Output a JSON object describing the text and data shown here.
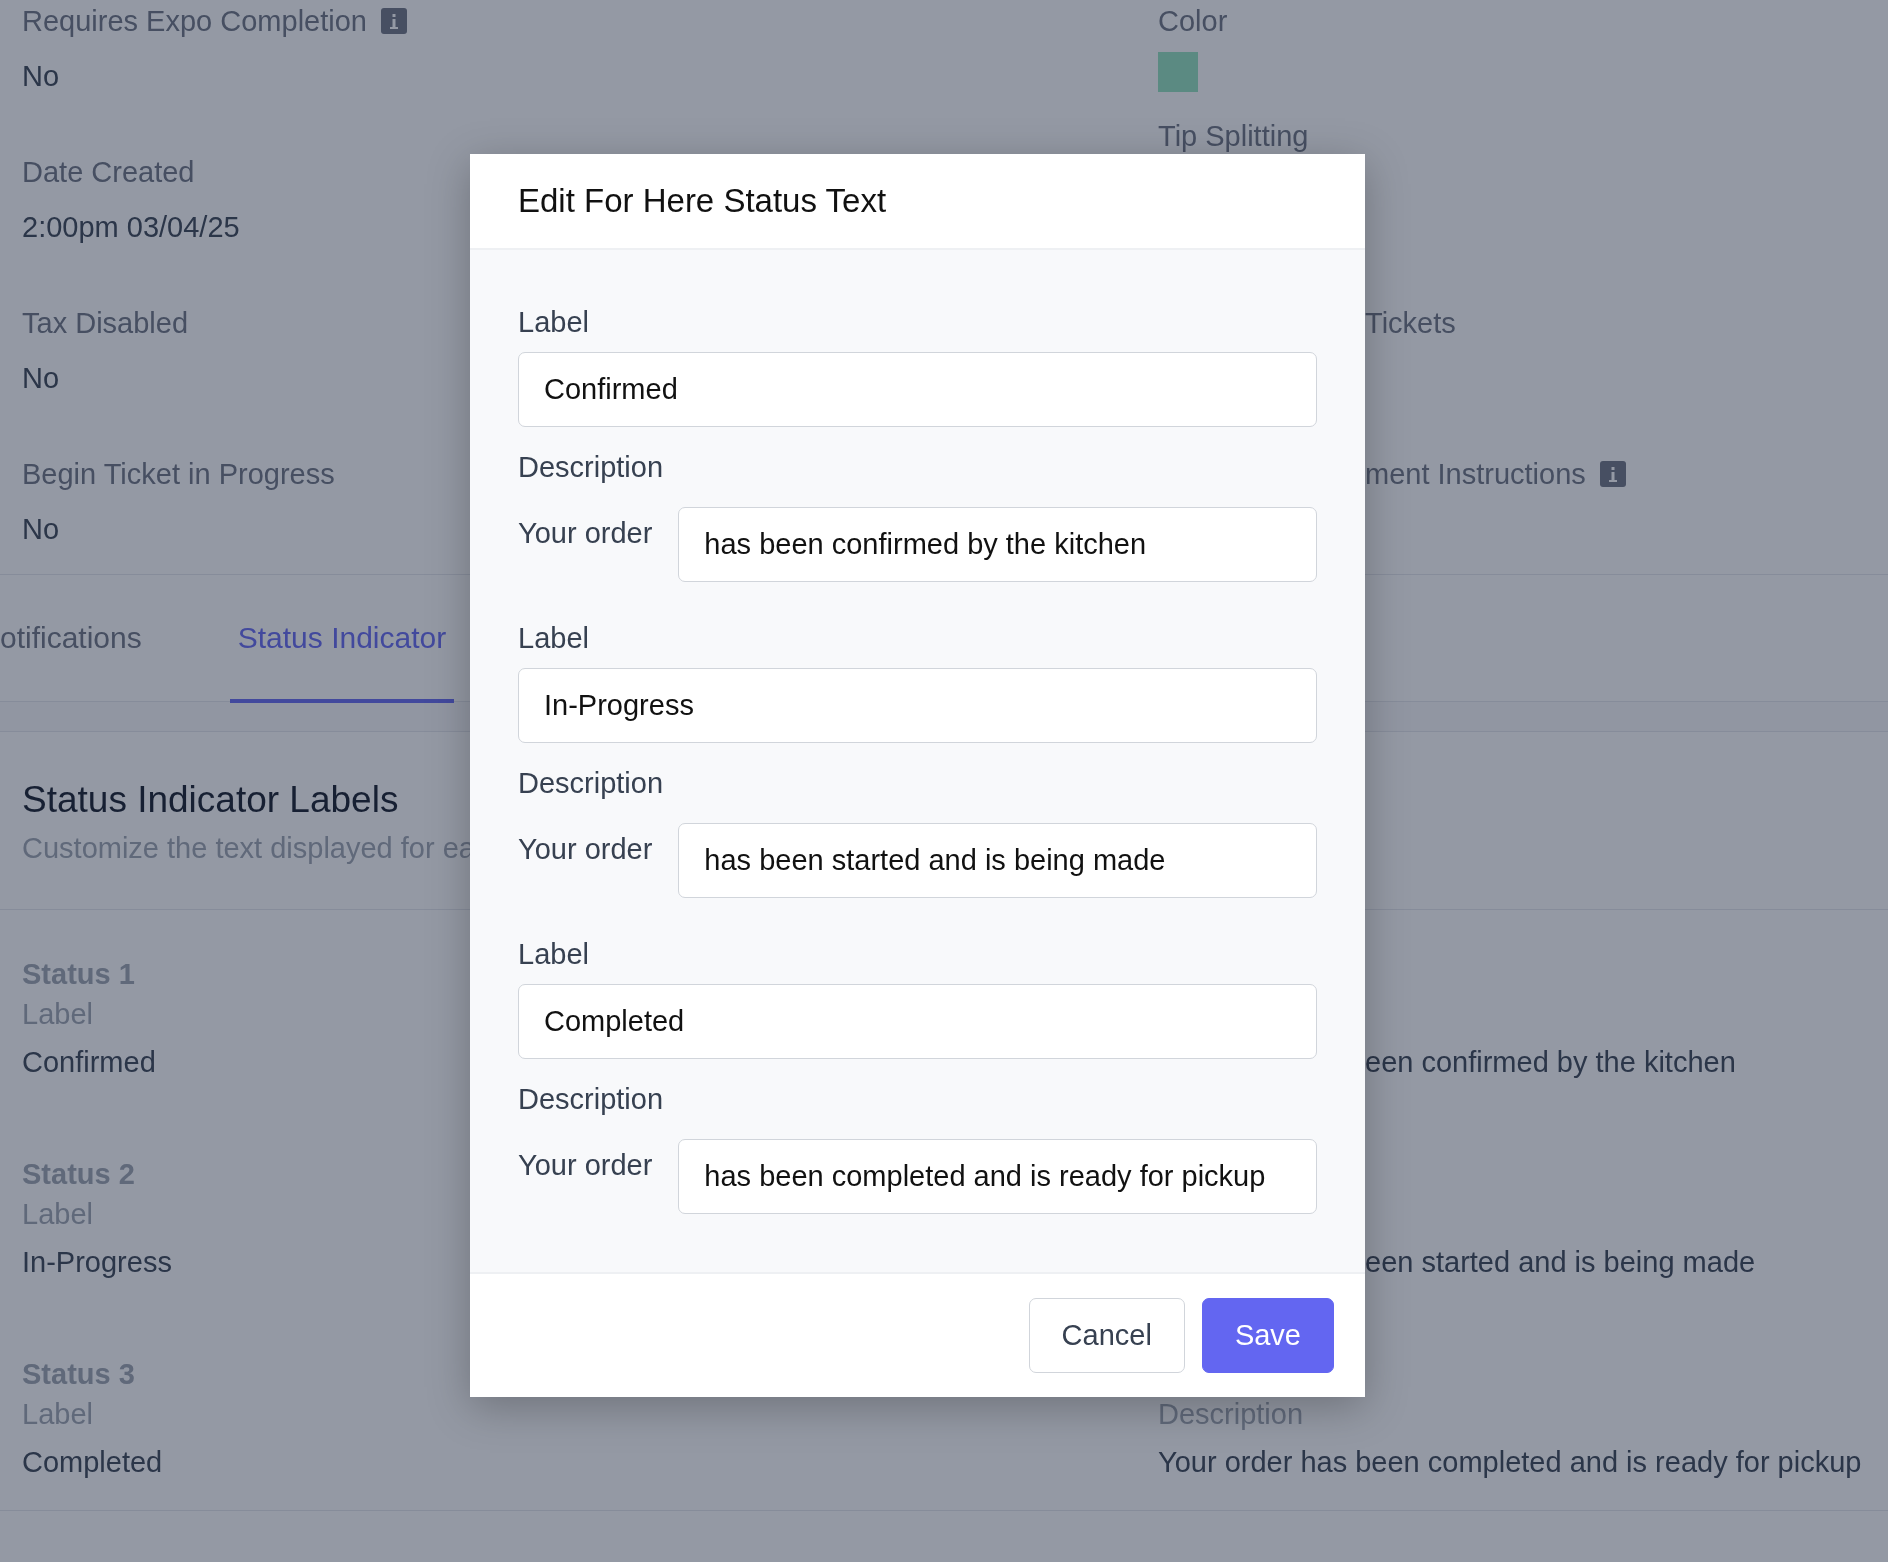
{
  "page": {
    "fields": [
      {
        "label": "Requires Expo Completion",
        "value": "No",
        "info": true
      },
      {
        "label": "Date Created",
        "value": "2:00pm 03/04/25",
        "info": false
      },
      {
        "label": "Tax Disabled",
        "value": "No",
        "info": false
      },
      {
        "label": "Begin Ticket in Progress",
        "value": "No",
        "info": false
      }
    ],
    "side_fields": [
      {
        "label": "Color",
        "color": "#5b8a82",
        "info": false,
        "covered": false
      },
      {
        "label": "Tip Splitting",
        "info": false,
        "covered": false
      },
      {
        "label": "Tickets",
        "info": false,
        "covered": true
      },
      {
        "label": "ment Instructions",
        "info": true,
        "covered": true
      }
    ],
    "tabs": [
      {
        "label": "otifications",
        "selected": false
      },
      {
        "label": "Status Indicator",
        "selected": true
      }
    ],
    "section": {
      "title": "Status Indicator Labels",
      "subtitle": "Customize the text displayed for ea"
    },
    "statuses": [
      {
        "title": "Status 1",
        "label_caption": "Label",
        "label": "Confirmed",
        "description": "een confirmed by the kitchen",
        "description_covered": true
      },
      {
        "title": "Status 2",
        "label_caption": "Label",
        "label": "In-Progress",
        "description": "een started and is being made",
        "description_covered": true
      },
      {
        "title": "Status 3",
        "label_caption": "Label",
        "label": "Completed",
        "description_caption": "Description",
        "description": "Your order has been completed and is ready for pickup",
        "description_covered": false
      }
    ]
  },
  "modal": {
    "title": "Edit For Here Status Text",
    "statuses": [
      {
        "label_caption": "Label",
        "label": "Confirmed",
        "description_caption": "Description",
        "prefix": "Your order",
        "description": "has been confirmed by the kitchen"
      },
      {
        "label_caption": "Label",
        "label": "In-Progress",
        "description_caption": "Description",
        "prefix": "Your order",
        "description": "has been started and is being made"
      },
      {
        "label_caption": "Label",
        "label": "Completed",
        "description_caption": "Description",
        "prefix": "Your order",
        "description": "has been completed and is ready for pickup"
      }
    ],
    "buttons": [
      {
        "label": "Cancel",
        "kind": "secondary"
      },
      {
        "label": "Save",
        "kind": "primary"
      }
    ]
  }
}
